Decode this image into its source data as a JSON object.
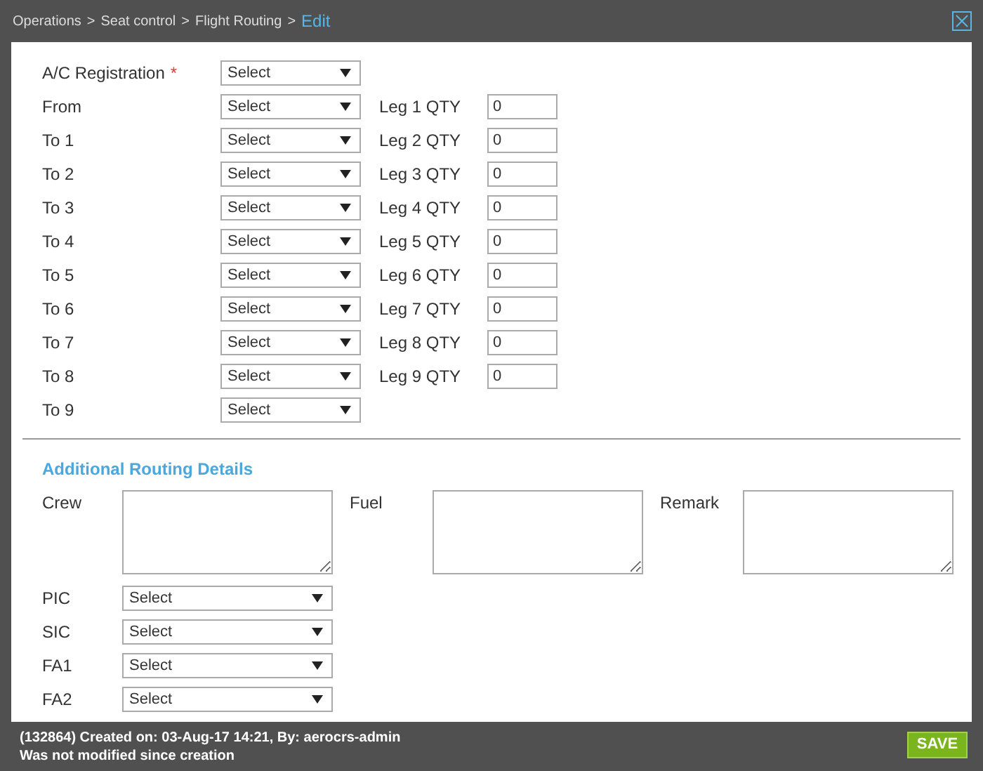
{
  "breadcrumb": {
    "path": [
      "Operations",
      "Seat control",
      "Flight Routing"
    ],
    "separator": ">",
    "current": "Edit"
  },
  "routing": [
    {
      "label": "A/C Registration",
      "required_mark": "*",
      "select": "Select"
    },
    {
      "label": "From",
      "select": "Select",
      "leg_label": "Leg 1 QTY",
      "leg_value": "0"
    },
    {
      "label": "To 1",
      "select": "Select",
      "leg_label": "Leg 2 QTY",
      "leg_value": "0"
    },
    {
      "label": "To 2",
      "select": "Select",
      "leg_label": "Leg 3 QTY",
      "leg_value": "0"
    },
    {
      "label": "To 3",
      "select": "Select",
      "leg_label": "Leg 4 QTY",
      "leg_value": "0"
    },
    {
      "label": "To 4",
      "select": "Select",
      "leg_label": "Leg 5 QTY",
      "leg_value": "0"
    },
    {
      "label": "To 5",
      "select": "Select",
      "leg_label": "Leg 6 QTY",
      "leg_value": "0"
    },
    {
      "label": "To 6",
      "select": "Select",
      "leg_label": "Leg 7 QTY",
      "leg_value": "0"
    },
    {
      "label": "To 7",
      "select": "Select",
      "leg_label": "Leg 8 QTY",
      "leg_value": "0"
    },
    {
      "label": "To 8",
      "select": "Select",
      "leg_label": "Leg 9 QTY",
      "leg_value": "0"
    },
    {
      "label": "To 9",
      "select": "Select"
    }
  ],
  "additional": {
    "title": "Additional Routing Details",
    "notes": [
      {
        "label": "Crew"
      },
      {
        "label": "Fuel"
      },
      {
        "label": "Remark"
      }
    ],
    "crew_selects": [
      {
        "label": "PIC",
        "select": "Select"
      },
      {
        "label": "SIC",
        "select": "Select"
      },
      {
        "label": "FA1",
        "select": "Select"
      },
      {
        "label": "FA2",
        "select": "Select"
      }
    ]
  },
  "footer": {
    "created": "(132864) Created on: 03-Aug-17 14:21, By: aerocrs-admin",
    "modified": "Was not modified since creation",
    "save": "SAVE"
  }
}
